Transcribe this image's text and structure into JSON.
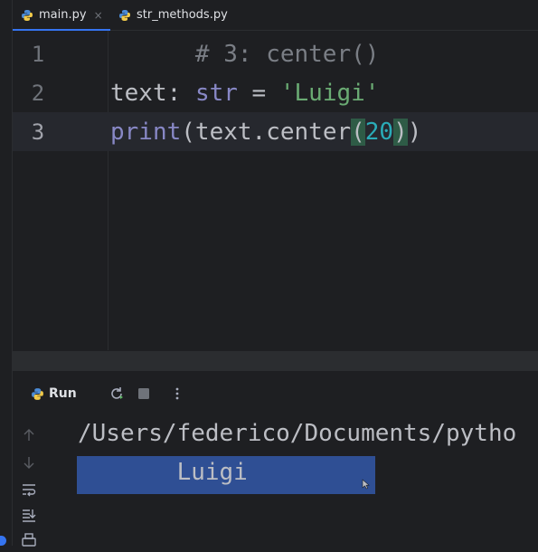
{
  "tabs": [
    {
      "label": "main.py",
      "close": "×",
      "active": true
    },
    {
      "label": "str_methods.py",
      "active": false
    }
  ],
  "editor": {
    "lines": [
      {
        "number": "1",
        "tokens": [
          {
            "text": "# 3: center()",
            "kind": "comment"
          }
        ]
      },
      {
        "number": "2",
        "tokens": [
          {
            "text": "text",
            "kind": "ident"
          },
          {
            "text": ": ",
            "kind": "op"
          },
          {
            "text": "str",
            "kind": "builtin"
          },
          {
            "text": " = ",
            "kind": "op"
          },
          {
            "text": "'Luigi'",
            "kind": "string"
          }
        ]
      },
      {
        "number": "3",
        "current": true,
        "tokens": [
          {
            "text": "print",
            "kind": "builtin"
          },
          {
            "text": "(text.center",
            "kind": "ident"
          },
          {
            "text": "(",
            "kind": "bracket-hl"
          },
          {
            "text": "20",
            "kind": "number"
          },
          {
            "text": ")",
            "kind": "bracket-hl"
          },
          {
            "text": ")",
            "kind": "ident"
          }
        ]
      }
    ]
  },
  "run_panel": {
    "title": "Run",
    "icons": [
      "rerun-icon",
      "stop-icon",
      "more-options-icon"
    ],
    "side_icons": [
      "arrow-up-icon",
      "arrow-down-icon",
      "soft-wrap-icon",
      "scroll-to-end-icon",
      "print-icon"
    ]
  },
  "console": {
    "path_line": "/Users/federico/Documents/pytho",
    "output_line": "       Luigi        "
  },
  "colors": {
    "background": "#1e1f22",
    "selection": "#2f4f94",
    "accent": "#3574f0",
    "string": "#6aab73",
    "number": "#2aacb8",
    "builtin": "#8888c6"
  }
}
